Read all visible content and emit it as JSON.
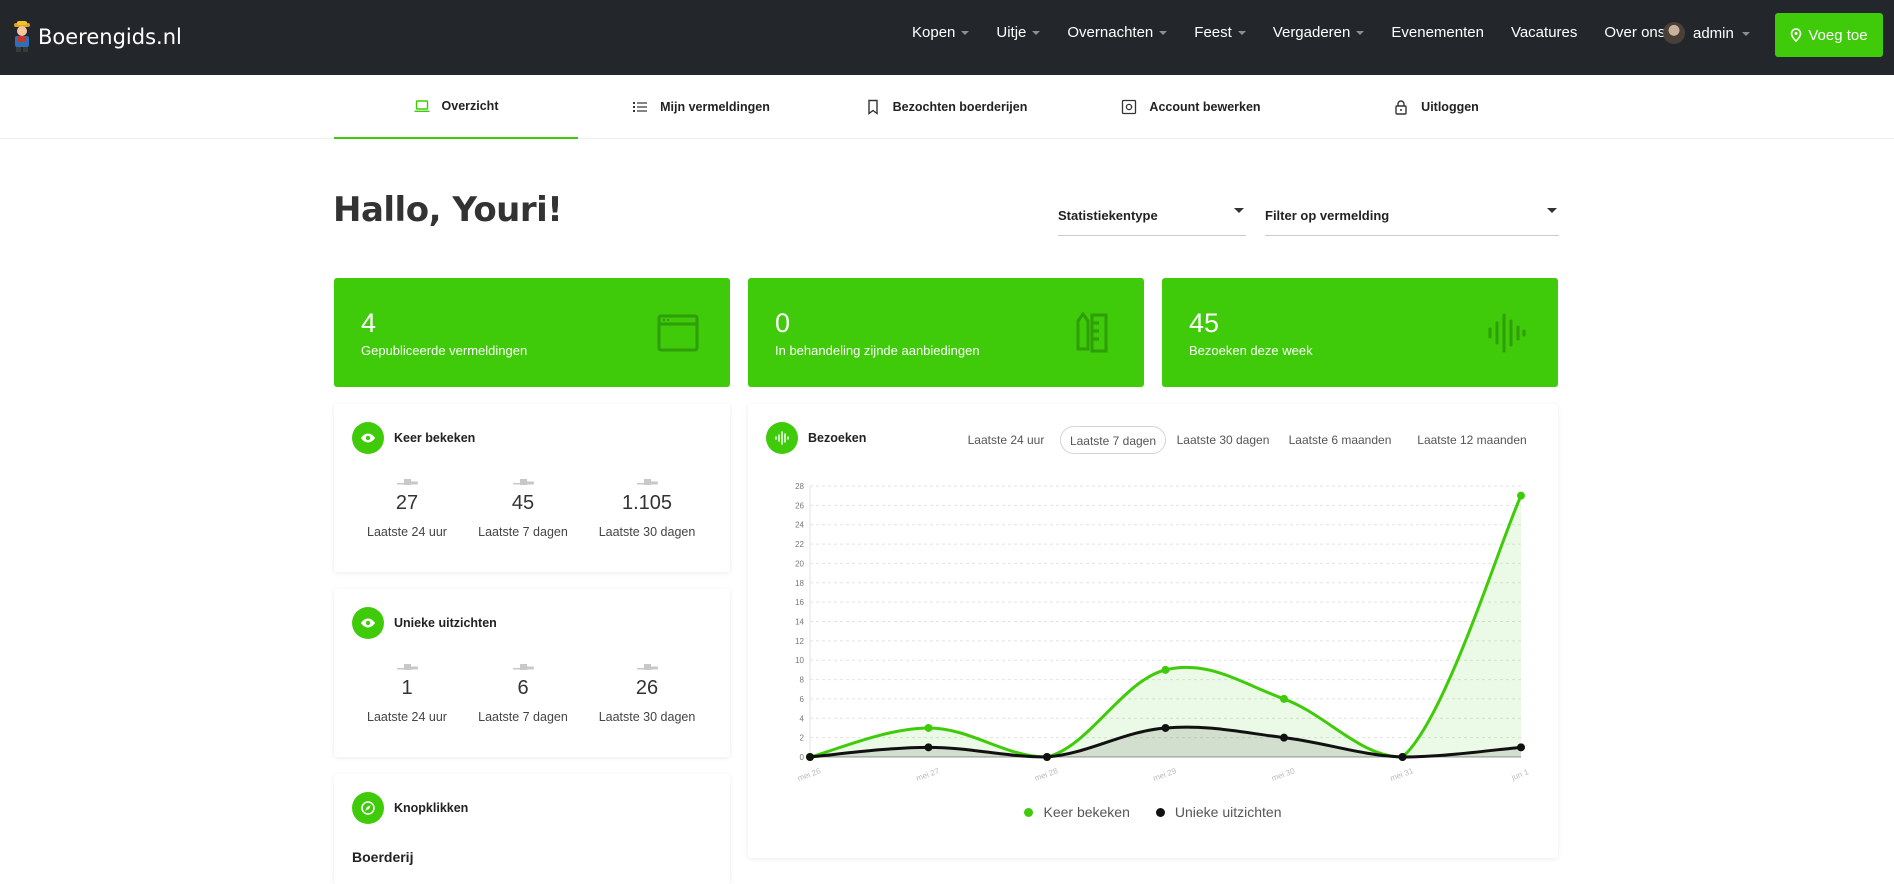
{
  "brand": {
    "name": "Boerengids.nl"
  },
  "nav": {
    "items": [
      {
        "label": "Kopen",
        "has_caret": true
      },
      {
        "label": "Uitje",
        "has_caret": true
      },
      {
        "label": "Overnachten",
        "has_caret": true
      },
      {
        "label": "Feest",
        "has_caret": true
      },
      {
        "label": "Vergaderen",
        "has_caret": true
      },
      {
        "label": "Evenementen",
        "has_caret": false
      },
      {
        "label": "Vacatures",
        "has_caret": false
      },
      {
        "label": "Over ons",
        "has_caret": true
      }
    ],
    "user": "admin",
    "add_button": "Voeg toe"
  },
  "tabs": [
    {
      "label": "Overzicht",
      "icon": "laptop-icon",
      "active": true
    },
    {
      "label": "Mijn vermeldingen",
      "icon": "list-icon",
      "active": false
    },
    {
      "label": "Bezochten boerderijen",
      "icon": "bookmark-icon",
      "active": false
    },
    {
      "label": "Account bewerken",
      "icon": "settings-icon",
      "active": false
    },
    {
      "label": "Uitloggen",
      "icon": "lock-icon",
      "active": false
    }
  ],
  "greeting": "Hallo, Youri!",
  "filters": {
    "type": "Statistiekentype",
    "listing": "Filter op vermelding"
  },
  "stats": [
    {
      "value": "4",
      "label": "Gepubliceerde vermeldingen",
      "icon": "browser-window-icon"
    },
    {
      "value": "0",
      "label": "In behandeling zijnde aanbiedingen",
      "icon": "ruler-pencil-icon"
    },
    {
      "value": "45",
      "label": "Bezoeken deze week",
      "icon": "sound-wave-icon"
    }
  ],
  "views": {
    "title": "Keer bekeken",
    "metrics": [
      {
        "value": "27",
        "caption": "Laatste 24 uur"
      },
      {
        "value": "45",
        "caption": "Laatste 7 dagen"
      },
      {
        "value": "1.105",
        "caption": "Laatste 30 dagen"
      }
    ]
  },
  "unique": {
    "title": "Unieke uitzichten",
    "metrics": [
      {
        "value": "1",
        "caption": "Laatste 24 uur"
      },
      {
        "value": "6",
        "caption": "Laatste 7 dagen"
      },
      {
        "value": "26",
        "caption": "Laatste 30 dagen"
      }
    ]
  },
  "clicks": {
    "title": "Knopklikken",
    "subheading": "Boerderij"
  },
  "visits": {
    "title": "Bezoeken",
    "ranges": [
      "Laatste 24 uur",
      "Laatste 7 dagen",
      "Laatste 30 dagen",
      "Laatste 6 maanden",
      "Laatste 12 maanden"
    ],
    "active_range": "Laatste 7 dagen"
  },
  "colors": {
    "accent": "#3fcb0a",
    "topbar": "#23262b",
    "series_views": "#3fcb0a",
    "series_unique": "#111111"
  },
  "chart_data": {
    "type": "line",
    "x": [
      "mei 26",
      "mei 27",
      "mei 28",
      "mei 29",
      "mei 30",
      "mei 31",
      "jun 1"
    ],
    "series": [
      {
        "name": "Keer bekeken",
        "values": [
          0,
          3,
          0,
          9,
          6,
          0,
          27
        ]
      },
      {
        "name": "Unieke uitzichten",
        "values": [
          0,
          1,
          0,
          3,
          2,
          0,
          1
        ]
      }
    ],
    "y_ticks": [
      "0",
      "2",
      "4",
      "6",
      "8",
      "10",
      "12",
      "14",
      "16",
      "18",
      "20",
      "22",
      "24",
      "26",
      "28"
    ],
    "ylim": [
      0,
      28
    ],
    "grid": true,
    "legend": "bottom",
    "area_fill": true
  }
}
